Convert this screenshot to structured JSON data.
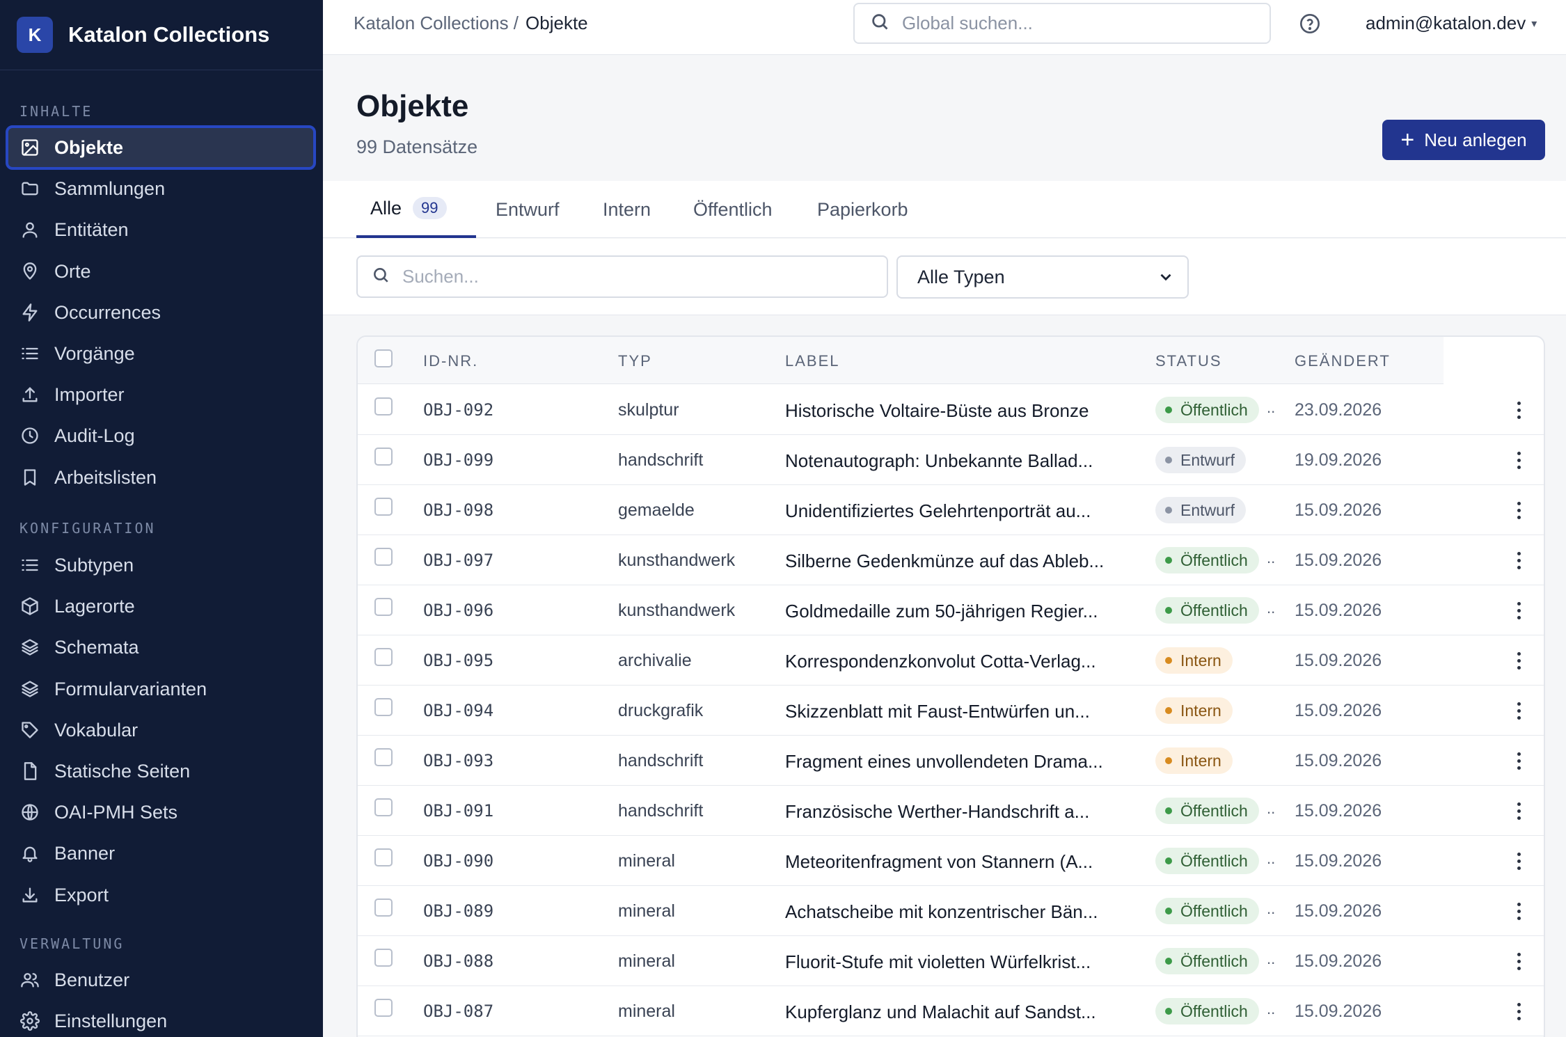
{
  "app": {
    "logo_letter": "K",
    "title": "Katalon Collections"
  },
  "sidebar": {
    "sections": [
      {
        "title": "INHALTE",
        "items": [
          {
            "label": "Objekte",
            "icon": "image-icon",
            "active": true
          },
          {
            "label": "Sammlungen",
            "icon": "folder-icon"
          },
          {
            "label": "Entitäten",
            "icon": "user-icon"
          },
          {
            "label": "Orte",
            "icon": "map-pin-icon"
          },
          {
            "label": "Occurrences",
            "icon": "bolt-icon"
          },
          {
            "label": "Vorgänge",
            "icon": "list-icon"
          },
          {
            "label": "Importer",
            "icon": "upload-icon"
          },
          {
            "label": "Audit-Log",
            "icon": "clock-icon"
          },
          {
            "label": "Arbeitslisten",
            "icon": "bookmark-icon"
          }
        ]
      },
      {
        "title": "KONFIGURATION",
        "items": [
          {
            "label": "Subtypen",
            "icon": "list-icon"
          },
          {
            "label": "Lagerorte",
            "icon": "box-icon"
          },
          {
            "label": "Schemata",
            "icon": "layers-icon"
          },
          {
            "label": "Formularvarianten",
            "icon": "layers-icon"
          },
          {
            "label": "Vokabular",
            "icon": "tag-icon"
          },
          {
            "label": "Statische Seiten",
            "icon": "file-icon"
          },
          {
            "label": "OAI-PMH Sets",
            "icon": "globe-icon"
          },
          {
            "label": "Banner",
            "icon": "bell-icon"
          },
          {
            "label": "Export",
            "icon": "download-icon"
          }
        ]
      },
      {
        "title": "VERWALTUNG",
        "items": [
          {
            "label": "Benutzer",
            "icon": "users-icon"
          },
          {
            "label": "Einstellungen",
            "icon": "gear-icon"
          }
        ]
      }
    ]
  },
  "header": {
    "breadcrumb_parent": "Katalon Collections /",
    "breadcrumb_current": "Objekte",
    "search_placeholder": "Global suchen...",
    "user": "admin@katalon.dev"
  },
  "page": {
    "title": "Objekte",
    "count_text": "99 Datensätze",
    "new_button": "Neu anlegen"
  },
  "tabs": [
    {
      "label": "Alle",
      "count": "99",
      "active": true
    },
    {
      "label": "Entwurf"
    },
    {
      "label": "Intern"
    },
    {
      "label": "Öffentlich"
    },
    {
      "label": "Papierkorb"
    }
  ],
  "filters": {
    "search_placeholder": "Suchen...",
    "type_select": "Alle Typen"
  },
  "table": {
    "columns": [
      "ID-NR.",
      "TYP",
      "LABEL",
      "STATUS",
      "GEÄNDERT"
    ],
    "rows": [
      {
        "id": "OBJ-092",
        "typ": "skulptur",
        "label": "Historische Voltaire-Büste aus Bronze",
        "status": "Öffentlich",
        "status_kind": "pub",
        "date": "23.09.2026"
      },
      {
        "id": "OBJ-099",
        "typ": "handschrift",
        "label": "Notenautograph: Unbekannte Ballad...",
        "status": "Entwurf",
        "status_kind": "draft",
        "date": "19.09.2026"
      },
      {
        "id": "OBJ-098",
        "typ": "gemaelde",
        "label": "Unidentifiziertes Gelehrtenporträt au...",
        "status": "Entwurf",
        "status_kind": "draft",
        "date": "15.09.2026"
      },
      {
        "id": "OBJ-097",
        "typ": "kunsthandwerk",
        "label": "Silberne Gedenkmünze auf das Ableb...",
        "status": "Öffentlich",
        "status_kind": "pub",
        "date": "15.09.2026"
      },
      {
        "id": "OBJ-096",
        "typ": "kunsthandwerk",
        "label": "Goldmedaille zum 50-jährigen Regier...",
        "status": "Öffentlich",
        "status_kind": "pub",
        "date": "15.09.2026"
      },
      {
        "id": "OBJ-095",
        "typ": "archivalie",
        "label": "Korrespondenzkonvolut Cotta-Verlag...",
        "status": "Intern",
        "status_kind": "int",
        "date": "15.09.2026"
      },
      {
        "id": "OBJ-094",
        "typ": "druckgrafik",
        "label": "Skizzenblatt mit Faust-Entwürfen un...",
        "status": "Intern",
        "status_kind": "int",
        "date": "15.09.2026"
      },
      {
        "id": "OBJ-093",
        "typ": "handschrift",
        "label": "Fragment eines unvollendeten Drama...",
        "status": "Intern",
        "status_kind": "int",
        "date": "15.09.2026"
      },
      {
        "id": "OBJ-091",
        "typ": "handschrift",
        "label": "Französische Werther-Handschrift a...",
        "status": "Öffentlich",
        "status_kind": "pub",
        "date": "15.09.2026"
      },
      {
        "id": "OBJ-090",
        "typ": "mineral",
        "label": "Meteoritenfragment von Stannern (A...",
        "status": "Öffentlich",
        "status_kind": "pub",
        "date": "15.09.2026"
      },
      {
        "id": "OBJ-089",
        "typ": "mineral",
        "label": "Achatscheibe mit konzentrischer Bän...",
        "status": "Öffentlich",
        "status_kind": "pub",
        "date": "15.09.2026"
      },
      {
        "id": "OBJ-088",
        "typ": "mineral",
        "label": "Fluorit-Stufe mit violetten Würfelkrist...",
        "status": "Öffentlich",
        "status_kind": "pub",
        "date": "15.09.2026"
      },
      {
        "id": "OBJ-087",
        "typ": "mineral",
        "label": "Kupferglanz und Malachit auf Sandst...",
        "status": "Öffentlich",
        "status_kind": "pub",
        "date": "15.09.2026"
      }
    ]
  },
  "colors": {
    "sidebar_bg": "#111c36",
    "accent": "#22358f",
    "public": "#3c9a48",
    "internal": "#d88b1f",
    "draft": "#8b93a3"
  }
}
